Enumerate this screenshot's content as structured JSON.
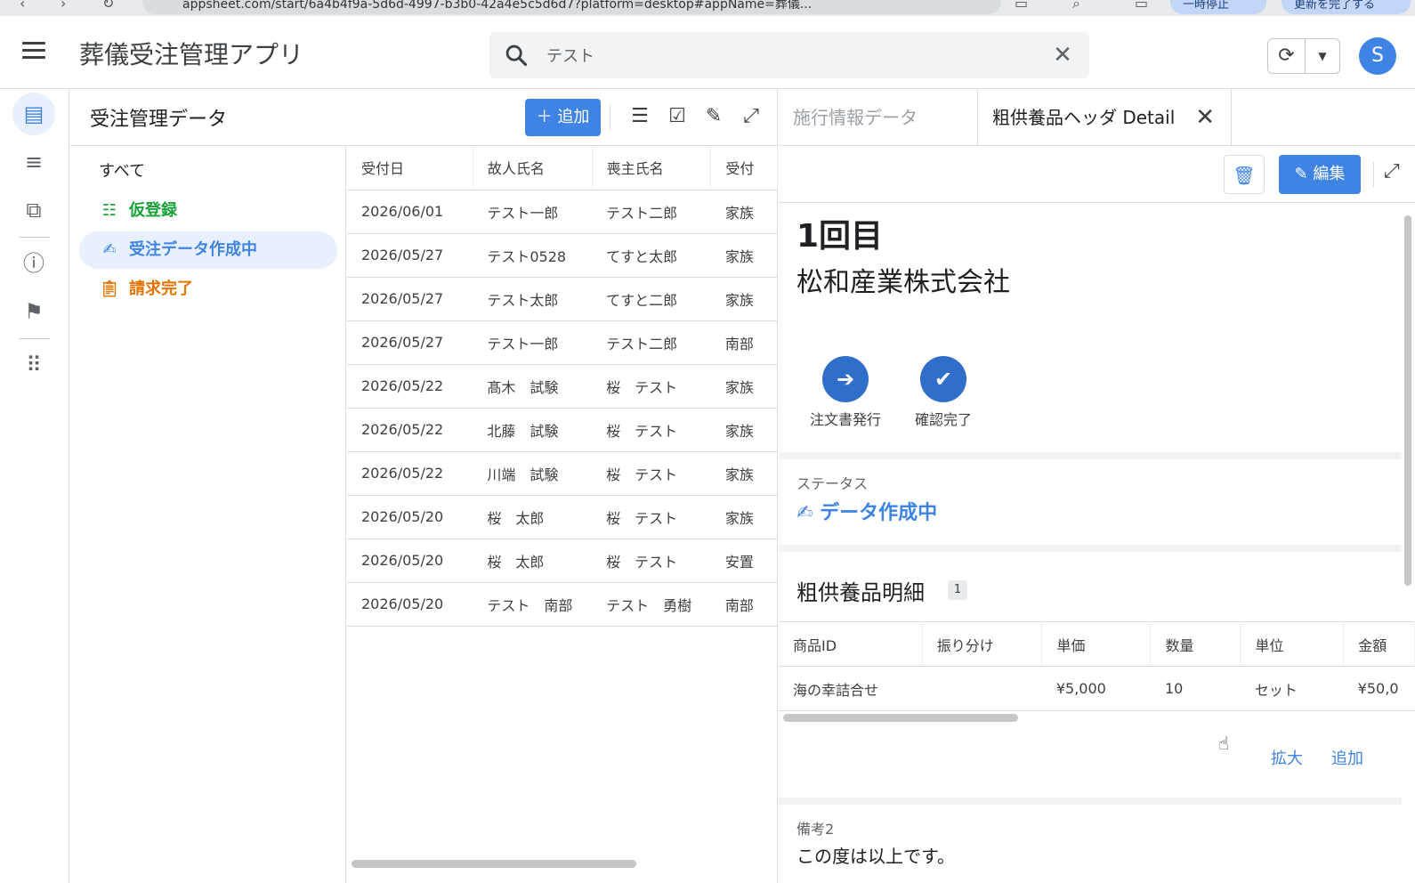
{
  "browser": {
    "url": "appsheet.com/start/6a4b4f9a-5d6d-4997-b3b0-42a4e5c5d6d7?platform=desktop#appName=葬儀...",
    "pill1": "一時停止",
    "pill2": "更新を完了する"
  },
  "appbar": {
    "title": "葬儀受注管理アプリ",
    "search_value": "テスト",
    "avatar": "S"
  },
  "list": {
    "title": "受注管理データ",
    "add_label": "追加",
    "slices": [
      {
        "label": "すべて",
        "color": "#202124"
      },
      {
        "label": "仮登録",
        "color": "#1aa23a"
      },
      {
        "label": "受注データ作成中",
        "color": "#3f84e5"
      },
      {
        "label": "請求完了",
        "color": "#e37400"
      }
    ],
    "columns": [
      "受付日",
      "故人氏名",
      "喪主氏名",
      "受付"
    ],
    "rows": [
      [
        "2026/06/01",
        "テスト一郎",
        "テスト二郎",
        "家族"
      ],
      [
        "2026/05/27",
        "テスト0528",
        "てすと太郎",
        "家族"
      ],
      [
        "2026/05/27",
        "テスト太郎",
        "てすと二郎",
        "家族"
      ],
      [
        "2026/05/27",
        "テスト一郎",
        "テスト二郎",
        "南部"
      ],
      [
        "2026/05/22",
        "髙木　試験",
        "桜　テスト",
        "家族"
      ],
      [
        "2026/05/22",
        "北藤　試験",
        "桜　テスト",
        "家族"
      ],
      [
        "2026/05/22",
        "川端　試験",
        "桜　テスト",
        "家族"
      ],
      [
        "2026/05/20",
        "桜　太郎",
        "桜　テスト",
        "家族"
      ],
      [
        "2026/05/20",
        "桜　太郎",
        "桜　テスト",
        "安置"
      ],
      [
        "2026/05/20",
        "テスト　南部",
        "テスト　勇樹",
        "南部"
      ]
    ]
  },
  "detail": {
    "tab_inactive": "施行情報データ",
    "tab_active": "粗供養品ヘッダ Detail",
    "edit_label": "編集",
    "number": "1回目",
    "company": "松和産業株式会社",
    "actions": [
      {
        "label": "注文書発行",
        "icon": "document-send-icon"
      },
      {
        "label": "確認完了",
        "icon": "check-circle-icon"
      }
    ],
    "status_label": "ステータス",
    "status_value": "データ作成中",
    "section_title": "粗供養品明細",
    "section_count": "1",
    "columns": [
      "商品ID",
      "振り分け",
      "単価",
      "数量",
      "単位",
      "金額"
    ],
    "rows": [
      [
        "海の幸詰合せ",
        "",
        "¥5,000",
        "10",
        "セット",
        "¥50,0"
      ]
    ],
    "expand_link": "拡大",
    "add_link": "追加",
    "remarks_label": "備考2",
    "remarks_value": "この度は以上です。"
  }
}
